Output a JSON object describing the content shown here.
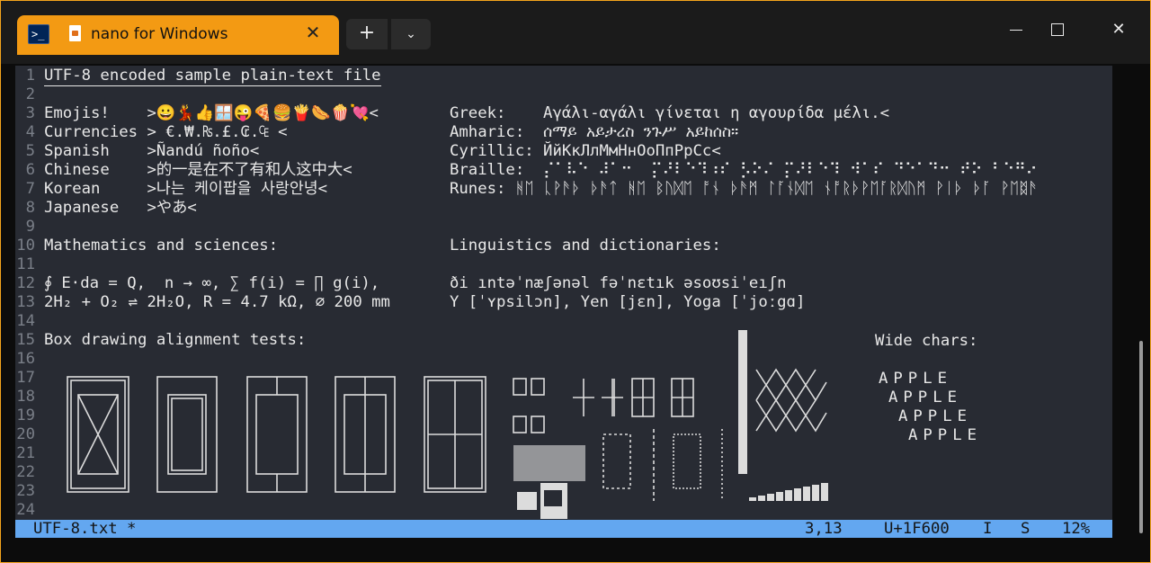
{
  "tab": {
    "title": "nano for Windows",
    "close_glyph": "✕"
  },
  "newtab_glyph": "+",
  "dropdown_glyph": "⌄",
  "window_close_glyph": "✕",
  "lines": [
    {
      "n": "1",
      "a": "UTF-8 encoded sample plain-text file",
      "b": ""
    },
    {
      "n": "2",
      "a": "",
      "b": ""
    },
    {
      "n": "3",
      "a": "Emojis!    >😀💃👍🪟😜🍕🍔🍟🌭🍿💘<",
      "b": "Greek:    Αγάλι-αγάλι γίνεται η αγουρίδα μέλι.<"
    },
    {
      "n": "4",
      "a": "Currencies > €.₩.₨.£.₢.₠ <",
      "b": "Amharic:  ሰማይ አይታረስ ንጉሥ አይከሰስ።"
    },
    {
      "n": "5",
      "a": "Spanish    >Ñandú ñoño<",
      "b": "Cyrillic: ЙйКкЛлМмНнОоПпРрСс<"
    },
    {
      "n": "6",
      "a": "Chinese    >的一是在不了有和人这中大<",
      "b": "Braille:  ⡌⠁⠧⠑ ⠼⠁⠒  ⡍⠜⠇⠑⠹⠰⠎ ⡣⠕⠌ ⡍⠜⠇⠑⠹ ⠺⠁⠎ ⠙⠑⠁⠙⠒ ⠞⠕ ⠃⠑⠛⠔"
    },
    {
      "n": "7",
      "a": "Korean     >나는 케이팝을 사랑안녕<",
      "b": "Runes: ᚻᛖ ᚳᚹᚫᚦ ᚦᚫᛏ ᚻᛖ ᛒᚢᛞᛖ ᚩᚾ ᚦᚫᛗ ᛚᚪᚾᛞᛖ ᚾᚩᚱᚦᚹᛖᚪᚱᛞᚢᛗ ᚹᛁᚦ ᚦᚪ ᚹᛖᛥᚫ"
    },
    {
      "n": "8",
      "a": "Japanese   >やあ<",
      "b": ""
    },
    {
      "n": "9",
      "a": "",
      "b": ""
    },
    {
      "n": "10",
      "a": "Mathematics and sciences:",
      "b": "Linguistics and dictionaries:"
    },
    {
      "n": "11",
      "a": "",
      "b": ""
    },
    {
      "n": "12",
      "a": "∮ E⋅da = Q,  n → ∞, ∑ f(i) = ∏ g(i),",
      "b": "ði ıntəˈnæʃənəl fəˈnɛtık əsoʊsiˈeıʃn"
    },
    {
      "n": "13",
      "a": "2H₂ + O₂ ⇌ 2H₂O, R = 4.7 kΩ, ⌀ 200 mm",
      "b": "Y [ˈʏpsilɔn], Yen [jɛn], Yoga [ˈjoːgɑ]"
    },
    {
      "n": "14",
      "a": "",
      "b": ""
    },
    {
      "n": "15",
      "a": "Box drawing alignment tests:",
      "b": ""
    },
    {
      "n": "16",
      "a": "",
      "b": ""
    },
    {
      "n": "17",
      "a": "",
      "b": ""
    },
    {
      "n": "18",
      "a": "",
      "b": ""
    },
    {
      "n": "19",
      "a": "",
      "b": ""
    },
    {
      "n": "20",
      "a": "",
      "b": ""
    },
    {
      "n": "21",
      "a": "",
      "b": ""
    },
    {
      "n": "22",
      "a": "",
      "b": ""
    },
    {
      "n": "23",
      "a": "",
      "b": ""
    },
    {
      "n": "24",
      "a": "",
      "b": ""
    }
  ],
  "wide_chars": {
    "label": "Wide chars:",
    "rows": [
      "APPLE",
      "APPLE",
      "APPLE",
      "APPLE"
    ]
  },
  "status": {
    "file": "UTF-8.txt *",
    "pos": "3,13",
    "codepoint": "U+1F600",
    "mode_i": "I",
    "mode_s": "S",
    "percent": "12%"
  }
}
